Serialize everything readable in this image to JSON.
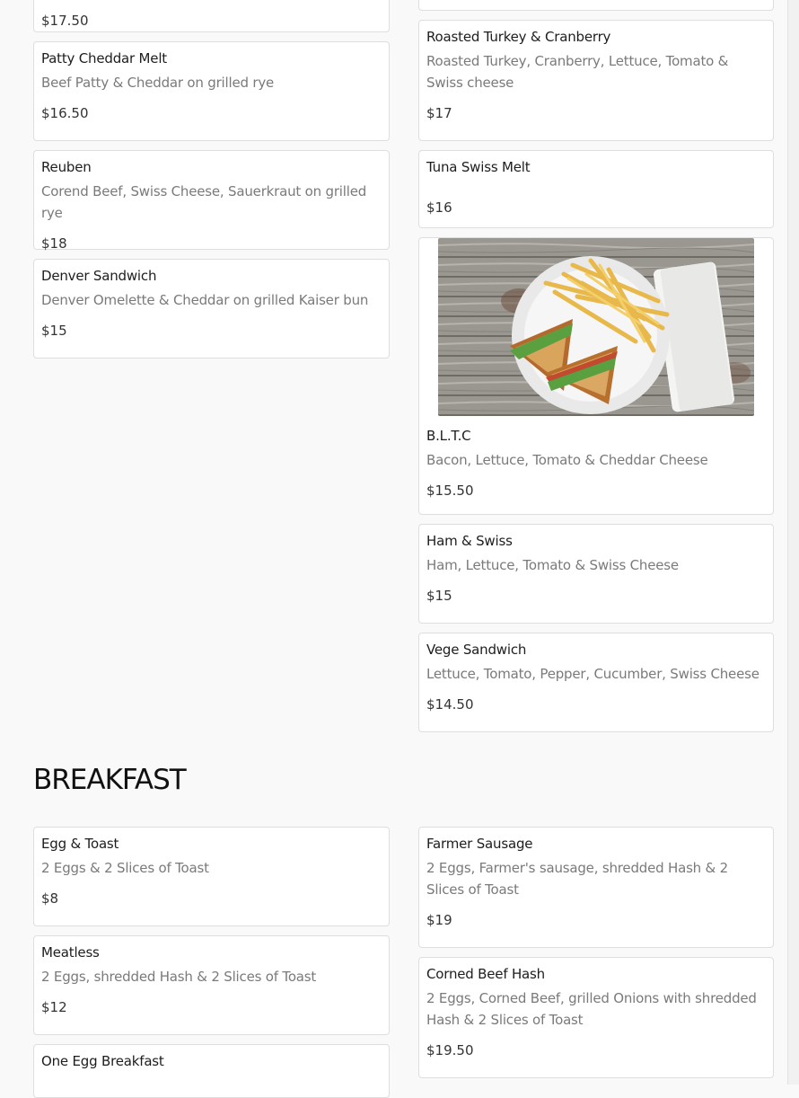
{
  "menu": {
    "top_left_price": "$17.50",
    "left_items": [
      {
        "name": "Patty Cheddar Melt",
        "desc": "Beef Patty & Cheddar on grilled rye",
        "price": "$16.50"
      },
      {
        "name": "Reuben",
        "desc": "Corend Beef, Swiss Cheese, Sauerkraut on grilled rye",
        "price": "$18"
      },
      {
        "name": "Denver Sandwich",
        "desc": "Denver Omelette & Cheddar on grilled Kaiser bun",
        "price": "$15"
      }
    ],
    "right_items": [
      {
        "name": "Roasted Turkey & Cranberry",
        "desc": "Roasted Turkey, Cranberry, Lettuce, Tomato & Swiss cheese",
        "price": "$17"
      },
      {
        "name": "Tuna Swiss Melt",
        "price": "$16"
      },
      {
        "name": "B.L.T.C",
        "desc": "Bacon, Lettuce, Tomato & Cheddar Cheese",
        "price": "$15.50"
      },
      {
        "name": "Ham & Swiss",
        "desc": "Ham, Lettuce, Tomato & Swiss Cheese",
        "price": "$15"
      },
      {
        "name": "Vege Sandwich",
        "desc": "Lettuce, Tomato, Pepper, Cucumber, Swiss Cheese",
        "price": "$14.50"
      }
    ]
  },
  "breakfast": {
    "title": "BREAKFAST",
    "left_items": [
      {
        "name": "Egg & Toast",
        "desc": "2 Eggs & 2 Slices of Toast",
        "price": "$8"
      },
      {
        "name": "Meatless",
        "desc": "2 Eggs, shredded Hash & 2 Slices of Toast",
        "price": "$12"
      },
      {
        "name": "One Egg Breakfast"
      }
    ],
    "right_items": [
      {
        "name": "Farmer Sausage",
        "desc": "2 Eggs, Farmer's sausage, shredded Hash & 2 Slices of Toast",
        "price": "$19"
      },
      {
        "name": "Corned Beef Hash",
        "desc": "2 Eggs, Corned Beef, grilled Onions with shredded Hash & 2 Slices of Toast",
        "price": "$19.50"
      }
    ]
  },
  "colors": {
    "page_bg": "#f9f9f9",
    "card_border": "#dedede",
    "desc_text": "#7a7a7a"
  },
  "icons": {
    "blt_photo": "sandwich-with-fries-photo"
  }
}
